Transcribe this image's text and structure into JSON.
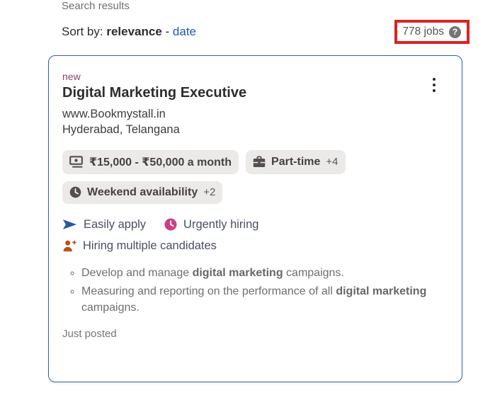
{
  "header": {
    "search_results_label": "Search results",
    "sort": {
      "label": "Sort by:",
      "relevance": "relevance",
      "separator": "-",
      "date": "date"
    },
    "jobs_count": "778 jobs",
    "help_glyph": "?"
  },
  "card": {
    "new_badge": "new",
    "title": "Digital Marketing Executive",
    "company": "www.Bookmystall.in",
    "location": "Hyderabad, Telangana",
    "badges": [
      {
        "name": "salary",
        "text": "₹15,000 - ₹50,000 a month",
        "extra": ""
      },
      {
        "name": "job-type",
        "text": "Part-time",
        "extra": "+4"
      },
      {
        "name": "shift",
        "text": "Weekend availability",
        "extra": "+2"
      }
    ],
    "attributes": [
      {
        "name": "easily-apply",
        "text": "Easily apply"
      },
      {
        "name": "urgently-hiring",
        "text": "Urgently hiring"
      },
      {
        "name": "hiring-multiple",
        "text": "Hiring multiple candidates"
      }
    ],
    "bullets": [
      {
        "pre": "Develop and manage ",
        "bold": "digital marketing",
        "post": " campaigns."
      },
      {
        "pre": "Measuring and reporting on the performance of all ",
        "bold": "digital marketing",
        "post": " campaigns."
      }
    ],
    "posted": "Just posted"
  },
  "colors": {
    "link_blue": "#2557a7",
    "card_border": "#3060a8",
    "annotation_red": "#dd2222",
    "badge_bg": "#eceae8",
    "new_badge": "#8a4368",
    "icon_gray": "#55504b",
    "urgent_pink": "#cc3f82",
    "hiring_orange": "#b4571e"
  }
}
